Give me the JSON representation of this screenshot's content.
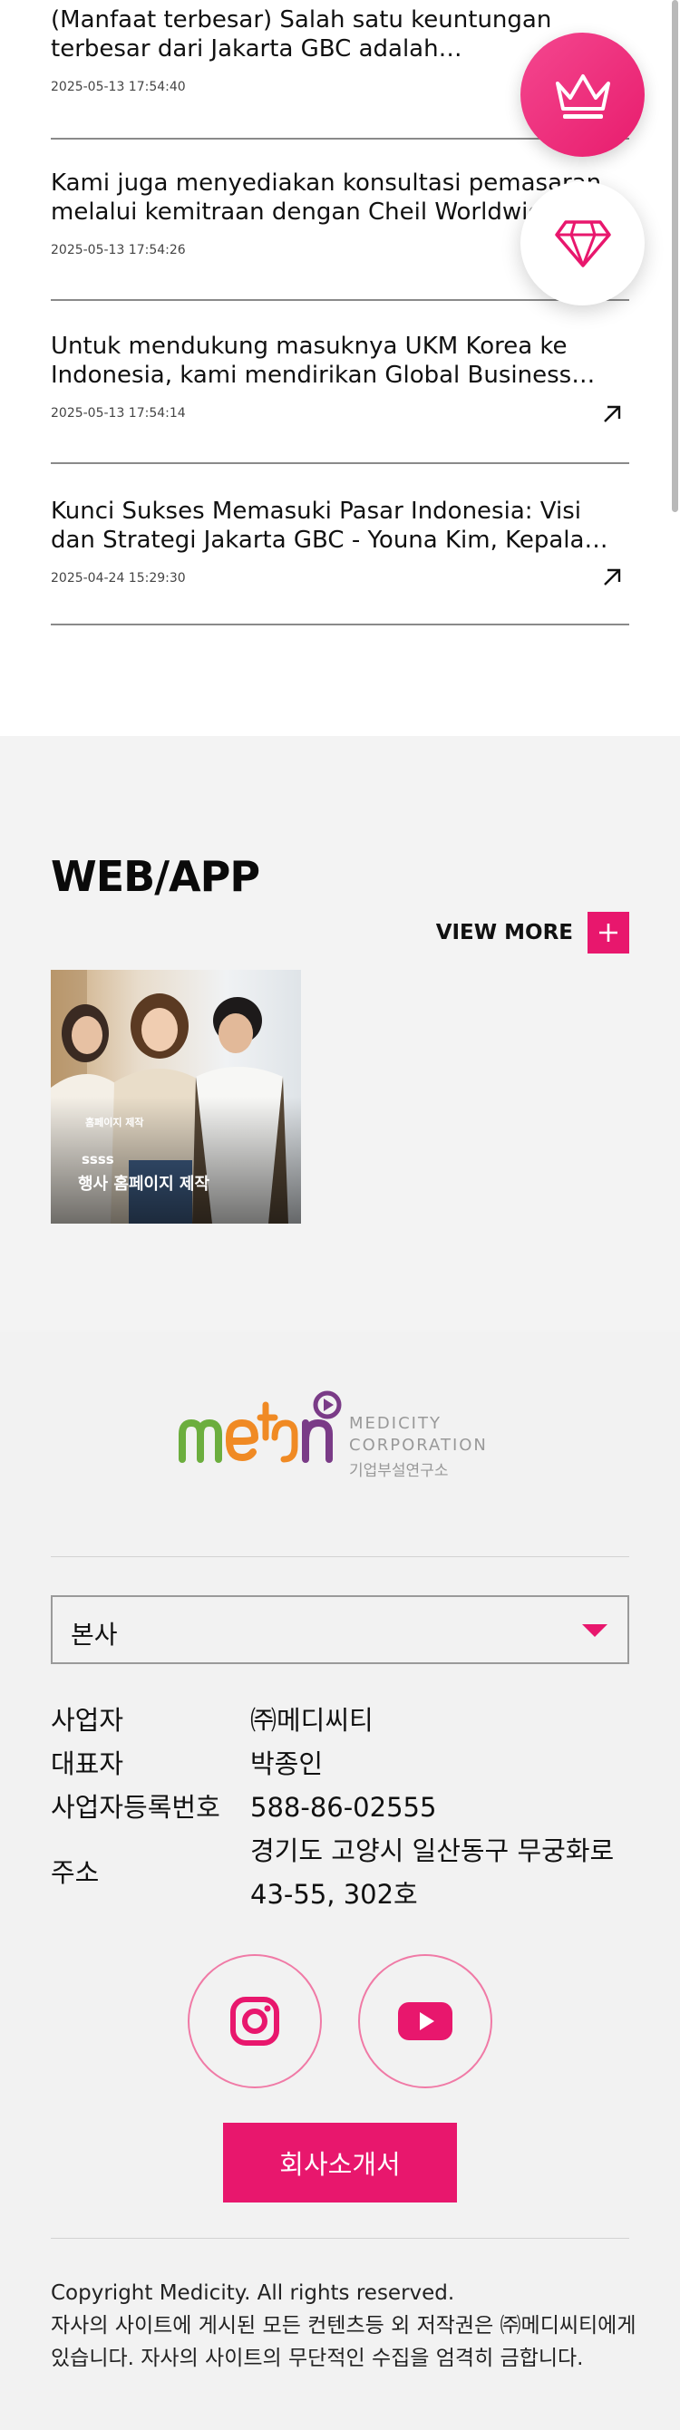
{
  "news": [
    {
      "title": "(Manfaat terbesar) Salah satu keuntungan terbesar dari Jakarta GBC adalah kemampuannya",
      "date": "2025-05-13 17:54:40",
      "arrow": false
    },
    {
      "title": "Kami juga menyediakan konsultasi pemasaran melalui kemitraan dengan Cheil Worldwide",
      "date": "2025-05-13 17:54:26",
      "arrow": false
    },
    {
      "title": "Untuk mendukung masuknya UKM Korea ke Indonesia, kami mendirikan Global Business Center",
      "date": "2025-05-13 17:54:14",
      "arrow": true
    },
    {
      "title": "Kunci Sukses Memasuki Pasar Indonesia: Visi dan Strategi Jakarta GBC - Youna Kim, Kepala Jakarta GBC",
      "date": "2025-04-24 15:29:30",
      "arrow": true
    }
  ],
  "fabs": {
    "crown_icon": "crown-icon",
    "diamond_icon": "diamond-icon"
  },
  "webapp": {
    "heading": "WEB/APP",
    "view_more": "VIEW MORE",
    "thumb": {
      "caption_small": "홈페이지 제작",
      "caption_mid": "ssss",
      "caption_main": "행사 홈페이지 제작"
    }
  },
  "footer": {
    "logo": {
      "line1": "MEDICITY",
      "line2": "CORPORATION",
      "line3": "기업부설연구소"
    },
    "select_value": "본사",
    "info": [
      {
        "label": "사업자",
        "value": "㈜메디씨티"
      },
      {
        "label": "대표자",
        "value": "박종인"
      },
      {
        "label": "사업자등록번호",
        "value": "588-86-02555"
      },
      {
        "label": "주소",
        "value": "경기도 고양시 일산동구 무궁화로 43-55, 302호"
      }
    ],
    "intro_button": "회사소개서",
    "copyright_line1": "Copyright Medicity. All rights reserved.",
    "copyright_line2": "자사의 사이트에 게시된 모든 컨텐츠등 외 저작권은 ㈜메디씨티에게 있습니다. 자사의 사이트의 무단적인 수집을 엄격히 금합니다."
  },
  "colors": {
    "accent": "#e8176d",
    "footer_bg": "#f2f2f2",
    "section_bg": "#f3f3f3"
  }
}
